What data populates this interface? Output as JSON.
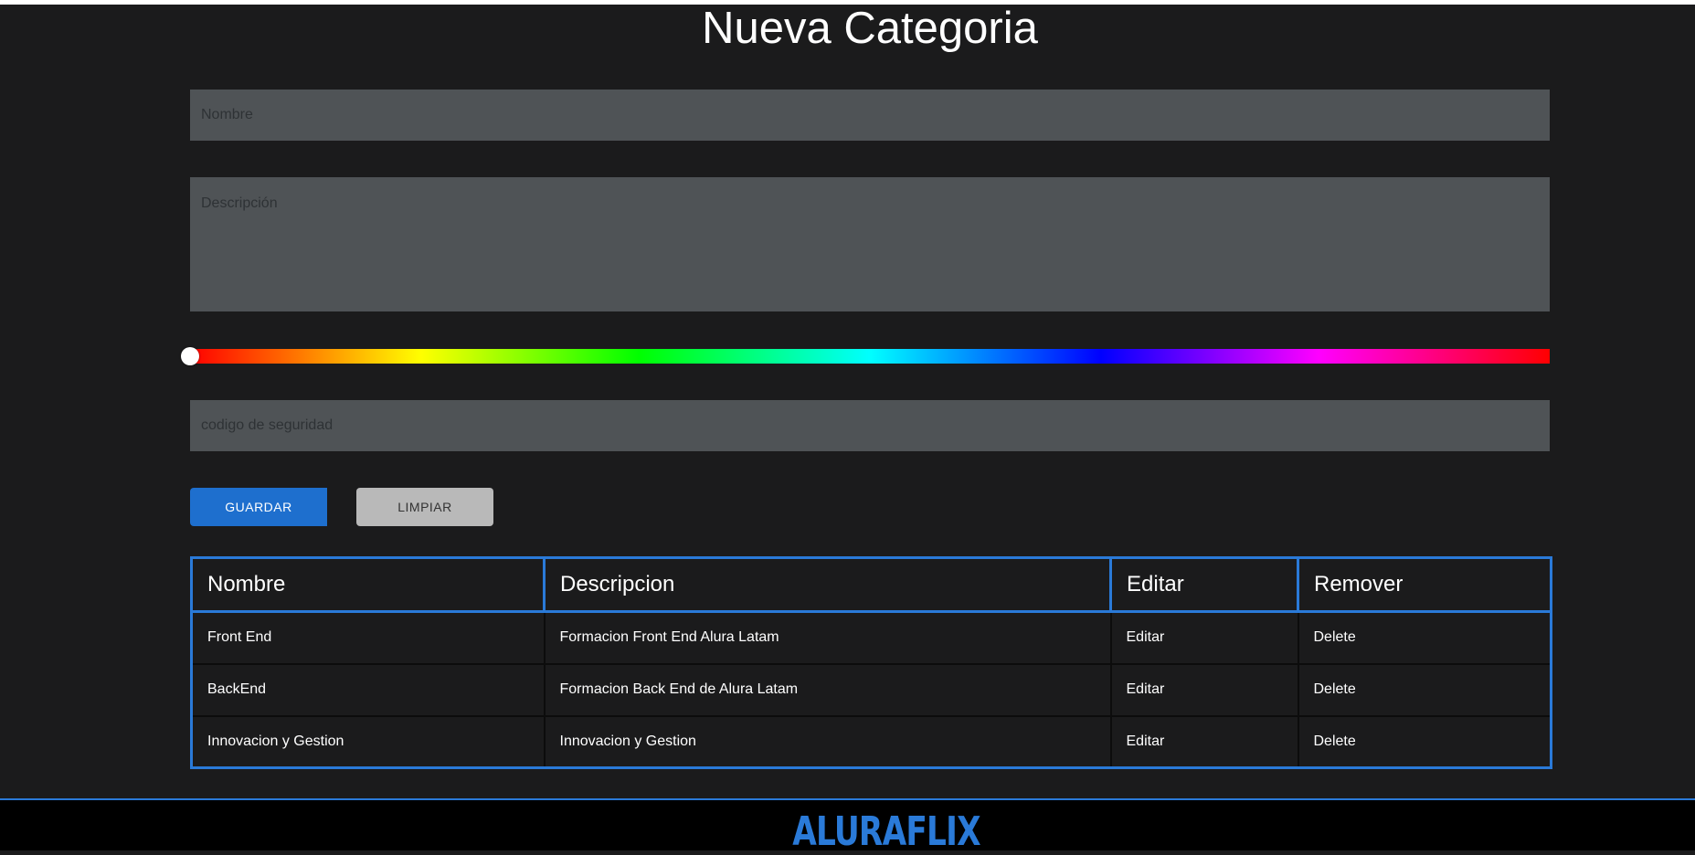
{
  "page": {
    "title": "Nueva Categoria"
  },
  "form": {
    "name_placeholder": "Nombre",
    "description_placeholder": "Descripción",
    "security_code_placeholder": "codigo de seguridad",
    "color_value": 0,
    "save_label": "GUARDAR",
    "clear_label": "LIMPIAR"
  },
  "table": {
    "headers": [
      "Nombre",
      "Descripcion",
      "Editar",
      "Remover"
    ],
    "rows": [
      {
        "name": "Front End",
        "description": "Formacion Front End Alura Latam",
        "edit": "Editar",
        "remove": "Delete"
      },
      {
        "name": "BackEnd",
        "description": "Formacion Back End de Alura Latam",
        "edit": "Editar",
        "remove": "Delete"
      },
      {
        "name": "Innovacion y Gestion",
        "description": "Innovacion y Gestion",
        "edit": "Editar",
        "remove": "Delete"
      }
    ]
  },
  "footer": {
    "logo_text": "ALURAFLIX"
  },
  "colors": {
    "background": "#1b1b1c",
    "field": "#4f5356",
    "primary": "#1e6fce",
    "accent_border": "#2a7ad8",
    "secondary_button": "#b9b9b9",
    "footer": "#000000"
  }
}
